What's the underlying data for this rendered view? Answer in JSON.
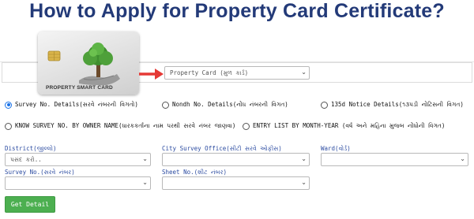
{
  "headline": "How to Apply for Property Card Certificate?",
  "card": {
    "label": "PROPERTY SMART CARD"
  },
  "service_select": {
    "value": "Property Card (મુળ કાર્ડ)"
  },
  "search_options": [
    {
      "label": "Survey No. Details(સરવે નંબરની વિગતો)",
      "selected": true
    },
    {
      "label": "Nondh No. Details(નોંધ નંબરની વિગત)",
      "selected": false
    },
    {
      "label": "135d Notice Details(૧૩૫ડી નોટિસની વિગત)",
      "selected": false
    },
    {
      "label": "KNOW SURVEY NO. BY OWNER NAME(ધારકકર્તાના નામ પરથી સરવે નંબર જાણવા)",
      "selected": false
    },
    {
      "label": "ENTRY LIST BY MONTH-YEAR (વર્ષ અને મહિના મુજબ નોંધોની વિગત)",
      "selected": false
    }
  ],
  "fields": {
    "district": {
      "label": "District(જીલ્લો)",
      "value": "પસંદ કરો.."
    },
    "city_survey_office": {
      "label": "City Survey Office(સીટી સરવે ઓફીસ)",
      "value": ""
    },
    "ward": {
      "label": "Ward(વોર્ડ)",
      "value": ""
    },
    "survey_no": {
      "label": "Survey No.(સરવે નંબર)",
      "value": ""
    },
    "sheet_no": {
      "label": "Sheet No.(શીટ નંબર)",
      "value": ""
    }
  },
  "get_detail_label": "Get Detail",
  "colors": {
    "headline": "#233a78",
    "button": "#4caf50",
    "arrow": "#e53935",
    "field_label": "#2a4aa0"
  }
}
